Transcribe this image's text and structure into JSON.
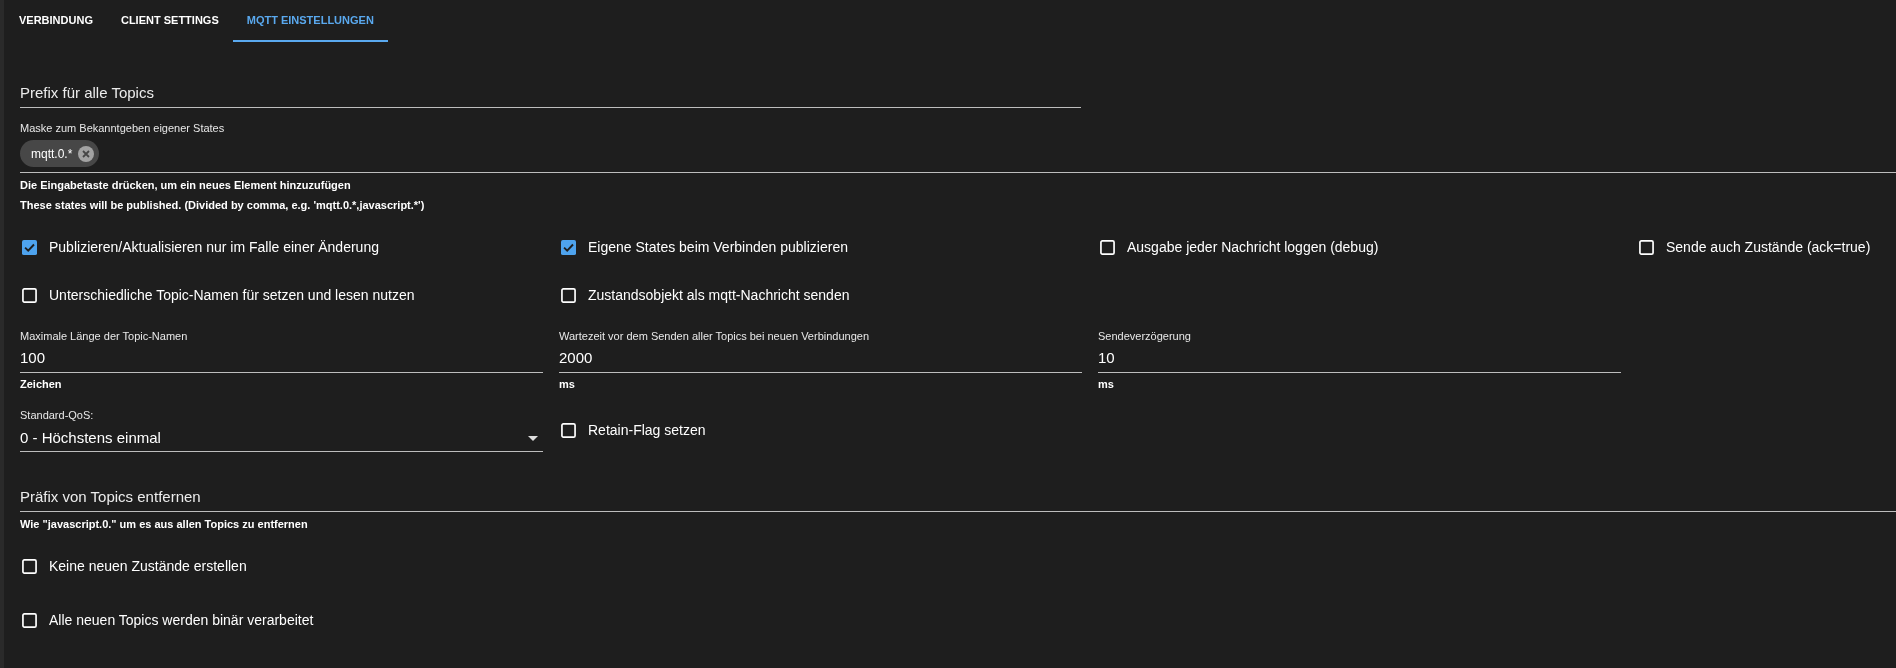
{
  "tabs": [
    {
      "label": "VERBINDUNG",
      "selected": false
    },
    {
      "label": "CLIENT SETTINGS",
      "selected": false
    },
    {
      "label": "MQTT EINSTELLUNGEN",
      "selected": true
    }
  ],
  "prefix_field": {
    "label": "Prefix für alle Topics"
  },
  "mask_field": {
    "label": "Maske zum Bekanntgeben eigener States",
    "chips": [
      {
        "text": "mqtt.0.*"
      }
    ],
    "helper_lines": [
      "Die Eingabetaste drücken, um ein neues Element hinzuzufügen",
      "These states will be published. (Divided by comma, e.g. 'mqtt.0.*,javascript.*')"
    ]
  },
  "options": [
    {
      "label": "Publizieren/Aktualisieren nur im Falle einer Änderung",
      "checked": true
    },
    {
      "label": "Eigene States beim Verbinden publizieren",
      "checked": true
    },
    {
      "label": "Ausgabe jeder Nachricht loggen (debug)",
      "checked": false
    },
    {
      "label": "Sende auch Zustände (ack=true)",
      "checked": false
    },
    {
      "label": "Unterschiedliche Topic-Namen für setzen und lesen nutzen",
      "checked": false
    },
    {
      "label": "Zustandsobjekt als mqtt-Nachricht senden",
      "checked": false
    }
  ],
  "number_fields": [
    {
      "label": "Maximale Länge der Topic-Namen",
      "value": "100",
      "unit": "Zeichen"
    },
    {
      "label": "Wartezeit vor dem Senden aller Topics bei neuen Verbindungen",
      "value": "2000",
      "unit": "ms"
    },
    {
      "label": "Sendeverzögerung",
      "value": "10",
      "unit": "ms"
    }
  ],
  "qos_select": {
    "label": "Standard-QoS:",
    "value": "0 - Höchstens einmal"
  },
  "retain_checkbox": {
    "label": "Retain-Flag setzen",
    "checked": false
  },
  "remove_prefix_field": {
    "label": "Präfix von Topics entfernen",
    "helper": "Wie \"javascript.0.\" um es aus allen Topics zu entfernen"
  },
  "bottom_options": [
    {
      "label": "Keine neuen Zustände erstellen",
      "checked": false
    },
    {
      "label": "Alle neuen Topics werden binär verarbeitet",
      "checked": false
    }
  ]
}
